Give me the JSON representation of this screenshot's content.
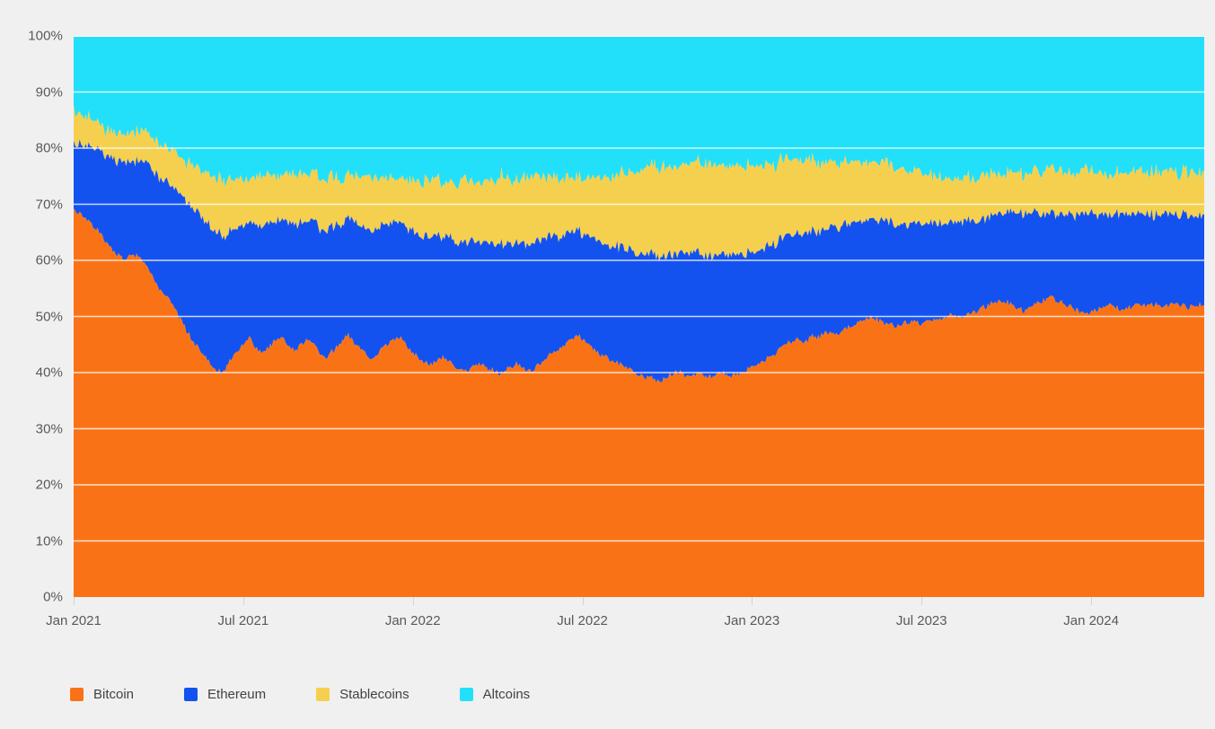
{
  "chart_data": {
    "type": "area",
    "stacked": true,
    "normalized": true,
    "title": "",
    "subtitle": "",
    "xlabel": "",
    "ylabel": "",
    "ylim": [
      0,
      100
    ],
    "y_unit": "%",
    "grid": true,
    "grid_axis": "y",
    "legend_position": "bottom-left",
    "background_color": "#f0f0f0",
    "plot_background_color": "#f0f0f0",
    "grid_color": "#ffffff",
    "axis_label_color": "#56595c",
    "x_axis_type": "date",
    "x_range": [
      "Jan 2021",
      "Apr 2024"
    ],
    "y_ticks": [
      "0%",
      "10%",
      "20%",
      "30%",
      "40%",
      "50%",
      "60%",
      "70%",
      "80%",
      "90%",
      "100%"
    ],
    "y_tick_values": [
      0,
      10,
      20,
      30,
      40,
      50,
      60,
      70,
      80,
      90,
      100
    ],
    "x_ticks": [
      "Jan 2021",
      "Jul 2021",
      "Jan 2022",
      "Jul 2022",
      "Jan 2023",
      "Jul 2023",
      "Jan 2024"
    ],
    "x_tick_positions_months": [
      0,
      6,
      12,
      18,
      24,
      30,
      36
    ],
    "legend": [
      {
        "name": "Bitcoin",
        "color": "#f97316"
      },
      {
        "name": "Ethereum",
        "color": "#1452f0"
      },
      {
        "name": "Stablecoins",
        "color": "#f5d04e"
      },
      {
        "name": "Altcoins",
        "color": "#22e0fa"
      }
    ],
    "series": [
      {
        "name": "Bitcoin",
        "color": "#f97316",
        "values": [
          69.0,
          68.6,
          67.9,
          67.0,
          66.2,
          65.8,
          64.9,
          63.4,
          62.1,
          61.8,
          61.0,
          60.3,
          60.6,
          61.2,
          60.8,
          60.0,
          58.9,
          57.6,
          56.2,
          55.0,
          54.1,
          53.0,
          51.8,
          50.4,
          49.0,
          47.6,
          46.2,
          45.0,
          44.1,
          43.2,
          42.0,
          41.0,
          40.3,
          40.0,
          41.2,
          42.6,
          43.5,
          44.4,
          45.6,
          46.2,
          45.2,
          44.0,
          43.4,
          44.2,
          45.0,
          46.0,
          46.6,
          45.7,
          44.6,
          43.8,
          44.4,
          45.4,
          46.0,
          45.2,
          44.2,
          43.2,
          42.6,
          43.4,
          44.2,
          45.0,
          45.9,
          46.6,
          45.6,
          44.6,
          43.8,
          43.0,
          42.4,
          43.0,
          43.8,
          44.6,
          45.2,
          45.8,
          46.6,
          45.8,
          44.8,
          43.8,
          43.0,
          42.4,
          41.8,
          41.2,
          41.6,
          42.4,
          43.0,
          42.2,
          41.6,
          41.0,
          40.6,
          40.2,
          40.6,
          41.2,
          41.8,
          41.4,
          40.8,
          40.4,
          40.0,
          39.8,
          40.4,
          41.0,
          41.6,
          41.2,
          40.6,
          40.2,
          40.6,
          41.4,
          42.0,
          42.6,
          43.2,
          43.8,
          44.4,
          45.0,
          45.6,
          46.2,
          46.8,
          46.0,
          45.2,
          44.4,
          43.8,
          43.2,
          42.8,
          42.4,
          42.0,
          41.6,
          41.2,
          40.8,
          40.4,
          40.0,
          39.6,
          39.2,
          39.0,
          38.8,
          38.6,
          39.0,
          39.4,
          39.8,
          40.2,
          39.8,
          39.4,
          39.0,
          39.4,
          39.8,
          39.4,
          39.0,
          39.2,
          39.6,
          40.0,
          39.6,
          39.2,
          39.6,
          40.0,
          40.4,
          40.8,
          41.2,
          41.6,
          42.0,
          42.4,
          43.0,
          43.6,
          44.2,
          44.8,
          45.4,
          46.0,
          45.6,
          45.2,
          45.8,
          46.4,
          46.0,
          46.6,
          47.2,
          47.0,
          46.8,
          47.2,
          47.6,
          48.0,
          48.4,
          48.8,
          49.2,
          49.6,
          50.0,
          49.6,
          49.2,
          48.8,
          48.6,
          48.4,
          48.6,
          48.8,
          49.0,
          49.2,
          49.0,
          48.8,
          49.0,
          49.2,
          49.4,
          49.6,
          49.8,
          50.0,
          50.2,
          50.0,
          49.8,
          50.0,
          50.4,
          50.8,
          51.2,
          51.6,
          52.0,
          52.4,
          52.8,
          53.0,
          52.6,
          52.2,
          51.8,
          51.4,
          51.0,
          51.4,
          51.8,
          52.2,
          52.6,
          53.0,
          53.4,
          53.0,
          52.6,
          52.2,
          51.8,
          51.4,
          51.0,
          50.6,
          50.2,
          50.6,
          51.0,
          51.4,
          51.8,
          52.2,
          51.8,
          51.4,
          51.0,
          51.4,
          51.8,
          52.2,
          52.0,
          51.8,
          52.0,
          52.2,
          52.0,
          51.8,
          52.0,
          52.2,
          52.4,
          52.0,
          51.6,
          51.8,
          52.0,
          52.2,
          52.0
        ]
      },
      {
        "name": "Ethereum",
        "color": "#1452f0",
        "values": [
          11.5,
          12.0,
          12.6,
          13.2,
          13.8,
          14.2,
          14.8,
          15.5,
          16.1,
          16.4,
          16.8,
          17.2,
          17.0,
          16.6,
          17.0,
          17.6,
          18.2,
          18.8,
          19.4,
          19.8,
          20.2,
          20.6,
          21.0,
          21.6,
          22.2,
          22.8,
          23.2,
          23.6,
          23.8,
          24.0,
          24.2,
          24.4,
          24.4,
          24.2,
          23.6,
          22.8,
          22.2,
          21.8,
          21.4,
          21.0,
          21.6,
          22.2,
          22.4,
          22.0,
          21.6,
          21.2,
          20.8,
          21.4,
          22.0,
          22.4,
          22.0,
          21.6,
          21.2,
          21.6,
          22.0,
          22.4,
          22.6,
          22.2,
          21.8,
          21.4,
          21.0,
          20.6,
          21.2,
          21.8,
          22.2,
          22.6,
          22.8,
          22.4,
          22.0,
          21.6,
          21.2,
          20.8,
          20.4,
          20.8,
          21.2,
          21.6,
          22.0,
          22.2,
          22.4,
          22.6,
          22.4,
          22.0,
          21.6,
          22.0,
          22.2,
          22.4,
          22.6,
          22.8,
          22.6,
          22.2,
          21.8,
          22.0,
          22.4,
          22.6,
          22.8,
          23.0,
          22.6,
          22.2,
          21.8,
          22.0,
          22.4,
          22.6,
          22.4,
          22.0,
          21.6,
          21.2,
          20.8,
          20.4,
          20.0,
          19.6,
          19.2,
          18.8,
          18.4,
          18.8,
          19.2,
          19.6,
          19.8,
          20.0,
          20.2,
          20.4,
          20.6,
          20.8,
          21.0,
          21.2,
          21.4,
          21.6,
          21.8,
          22.0,
          22.0,
          22.0,
          22.0,
          21.8,
          21.6,
          21.4,
          21.2,
          21.4,
          21.6,
          21.8,
          21.6,
          21.4,
          21.6,
          21.8,
          21.6,
          21.4,
          21.2,
          21.4,
          21.6,
          21.4,
          21.2,
          21.0,
          20.8,
          20.6,
          20.4,
          20.2,
          20.0,
          19.8,
          19.6,
          19.4,
          19.2,
          19.0,
          18.8,
          19.0,
          19.2,
          19.0,
          18.8,
          19.0,
          18.8,
          18.6,
          18.8,
          19.0,
          18.8,
          18.6,
          18.4,
          18.2,
          18.0,
          17.8,
          17.6,
          17.4,
          17.6,
          17.8,
          18.0,
          18.2,
          18.4,
          18.2,
          18.0,
          17.8,
          17.6,
          17.8,
          18.0,
          17.8,
          17.6,
          17.4,
          17.2,
          17.0,
          16.8,
          16.6,
          16.8,
          17.0,
          16.8,
          16.6,
          16.4,
          16.2,
          16.0,
          15.8,
          15.6,
          15.4,
          15.2,
          15.6,
          16.0,
          16.4,
          16.8,
          17.2,
          16.8,
          16.4,
          16.0,
          15.6,
          15.2,
          14.8,
          15.2,
          15.6,
          16.0,
          16.4,
          16.8,
          17.2,
          17.6,
          18.0,
          17.6,
          17.2,
          16.8,
          16.4,
          16.0,
          16.4,
          16.8,
          17.2,
          16.8,
          16.4,
          16.0,
          16.2,
          16.4,
          16.2,
          16.0,
          16.2,
          16.4,
          16.2,
          16.0,
          15.8,
          16.2,
          16.6,
          16.4,
          16.2,
          16.0,
          16.2
        ]
      },
      {
        "name": "Stablecoins",
        "color": "#f5d04e",
        "values": [
          5.8,
          5.6,
          5.4,
          5.2,
          5.0,
          4.9,
          4.8,
          4.8,
          4.7,
          4.8,
          4.9,
          5.0,
          5.1,
          5.0,
          5.1,
          5.2,
          5.3,
          5.5,
          5.6,
          5.8,
          6.0,
          6.2,
          6.4,
          6.6,
          6.8,
          7.0,
          7.4,
          7.8,
          8.2,
          8.6,
          9.0,
          9.4,
          9.8,
          10.2,
          10.0,
          9.4,
          9.0,
          8.6,
          8.2,
          7.8,
          8.2,
          8.8,
          9.2,
          8.8,
          8.4,
          8.0,
          7.8,
          8.2,
          8.8,
          9.2,
          8.8,
          8.4,
          8.0,
          8.4,
          8.8,
          9.2,
          9.4,
          9.0,
          8.6,
          8.2,
          7.8,
          7.6,
          8.0,
          8.4,
          8.8,
          9.2,
          9.4,
          9.0,
          8.6,
          8.2,
          8.0,
          7.8,
          7.6,
          8.0,
          8.4,
          8.8,
          9.2,
          9.6,
          10.0,
          10.4,
          10.2,
          9.8,
          9.4,
          9.8,
          10.2,
          10.6,
          11.0,
          11.4,
          11.0,
          10.6,
          10.2,
          10.6,
          11.0,
          11.4,
          11.8,
          12.2,
          11.8,
          11.4,
          11.0,
          11.4,
          11.8,
          12.2,
          12.0,
          11.6,
          11.2,
          10.8,
          10.6,
          10.4,
          10.2,
          10.0,
          9.8,
          9.6,
          9.4,
          9.8,
          10.2,
          10.6,
          11.0,
          11.4,
          11.8,
          12.2,
          12.6,
          13.0,
          13.4,
          13.8,
          14.2,
          14.6,
          15.0,
          15.4,
          15.6,
          15.8,
          16.0,
          15.8,
          15.6,
          15.4,
          15.2,
          15.6,
          16.0,
          16.4,
          16.2,
          16.0,
          16.2,
          16.4,
          16.2,
          16.0,
          15.8,
          16.0,
          16.2,
          16.0,
          15.8,
          15.6,
          15.4,
          15.2,
          15.0,
          14.8,
          14.6,
          14.4,
          14.2,
          14.0,
          13.8,
          13.6,
          13.4,
          13.2,
          13.0,
          12.8,
          12.6,
          12.4,
          12.2,
          12.0,
          11.8,
          11.6,
          11.4,
          11.2,
          11.0,
          10.8,
          10.6,
          10.4,
          10.2,
          10.0,
          10.2,
          10.4,
          10.6,
          10.4,
          10.2,
          10.0,
          9.8,
          9.6,
          9.4,
          9.2,
          9.0,
          8.8,
          8.6,
          8.4,
          8.2,
          8.0,
          7.8,
          7.6,
          7.4,
          7.2,
          7.4,
          7.6,
          7.8,
          8.0,
          7.8,
          7.6,
          7.4,
          7.2,
          7.0,
          6.8,
          7.0,
          7.2,
          7.0,
          6.8,
          7.0,
          7.2,
          7.4,
          7.6,
          7.8,
          8.0,
          7.8,
          7.6,
          7.4,
          7.2,
          7.4,
          7.6,
          7.8,
          8.0,
          7.8,
          7.6,
          7.4,
          7.2,
          7.0,
          7.2,
          7.4,
          7.2,
          7.4,
          7.6,
          7.8,
          7.6,
          7.4,
          7.6,
          7.8,
          7.6,
          7.4,
          7.6,
          7.8,
          7.6,
          7.4,
          7.6,
          7.8,
          7.6,
          7.4,
          7.6
        ]
      },
      {
        "name": "Altcoins",
        "color": "#22e0fa",
        "values": [
          13.7,
          13.8,
          14.1,
          14.6,
          15.0,
          15.1,
          15.5,
          16.3,
          17.1,
          17.0,
          17.3,
          17.5,
          17.3,
          17.2,
          17.1,
          17.2,
          17.6,
          18.1,
          18.8,
          19.4,
          19.7,
          20.2,
          20.8,
          21.4,
          22.0,
          22.6,
          23.2,
          23.6,
          23.9,
          24.2,
          24.8,
          25.2,
          25.5,
          25.6,
          25.2,
          25.2,
          25.3,
          25.2,
          24.8,
          25.0,
          25.0,
          25.0,
          25.0,
          25.0,
          25.0,
          24.8,
          24.8,
          24.7,
          24.6,
          24.6,
          24.8,
          24.6,
          24.8,
          24.8,
          25.0,
          24.8,
          25.4,
          25.4,
          25.4,
          25.4,
          25.3,
          25.2,
          25.2,
          25.2,
          25.2,
          25.2,
          25.4,
          25.6,
          25.6,
          25.6,
          25.6,
          25.6,
          25.4,
          25.4,
          25.6,
          25.8,
          25.8,
          25.8,
          25.8,
          25.8,
          25.8,
          25.8,
          26.0,
          26.0,
          26.0,
          26.0,
          25.8,
          25.6,
          25.8,
          26.0,
          26.2,
          26.0,
          25.8,
          25.6,
          25.4,
          25.2,
          25.2,
          25.4,
          25.6,
          25.4,
          25.2,
          25.0,
          25.0,
          25.0,
          25.2,
          25.4,
          25.4,
          25.4,
          25.4,
          25.4,
          25.4,
          25.4,
          25.4,
          25.4,
          25.4,
          25.4,
          25.4,
          25.4,
          25.2,
          25.0,
          24.8,
          24.6,
          24.4,
          24.2,
          24.0,
          23.8,
          23.6,
          23.4,
          23.4,
          23.4,
          23.4,
          23.4,
          23.4,
          23.4,
          23.4,
          23.2,
          23.0,
          22.8,
          23.0,
          23.2,
          23.2,
          23.4,
          23.0,
          23.0,
          23.0,
          23.0,
          23.0,
          23.0,
          23.0,
          23.0,
          23.0,
          23.0,
          23.0,
          23.0,
          23.0,
          22.8,
          22.6,
          22.4,
          22.2,
          22.0,
          21.8,
          22.2,
          22.6,
          22.4,
          22.2,
          22.6,
          22.4,
          22.4,
          22.4,
          22.6,
          22.6,
          22.6,
          22.6,
          22.6,
          22.6,
          22.6,
          22.6,
          22.6,
          22.6,
          22.6,
          22.6,
          22.8,
          23.0,
          23.2,
          23.4,
          23.6,
          23.8,
          24.0,
          24.2,
          24.4,
          24.6,
          24.8,
          25.0,
          25.2,
          25.4,
          25.6,
          25.8,
          26.0,
          25.8,
          25.4,
          25.0,
          24.6,
          24.6,
          24.6,
          24.6,
          24.6,
          24.8,
          25.0,
          24.8,
          24.6,
          24.8,
          25.0,
          24.8,
          24.4,
          24.2,
          24.0,
          24.0,
          24.2,
          24.0,
          24.2,
          24.4,
          24.6,
          24.2,
          23.8,
          23.8,
          23.8,
          24.0,
          24.2,
          24.4,
          24.6,
          24.8,
          24.6,
          24.4,
          24.6,
          24.4,
          24.2,
          24.0,
          24.2,
          24.8,
          24.2,
          24.0,
          24.2,
          24.4,
          24.2,
          24.0,
          24.2,
          24.4,
          24.2,
          24.0,
          24.2,
          24.4,
          24.2
        ]
      }
    ]
  }
}
